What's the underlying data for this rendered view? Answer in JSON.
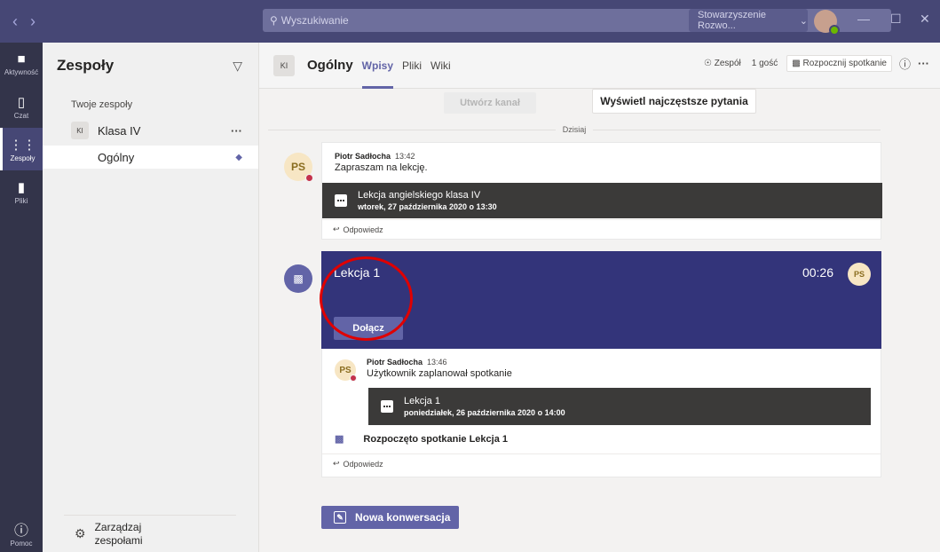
{
  "titlebar": {
    "search_placeholder": "Wyszukiwanie",
    "org_name": "Stowarzyszenie Rozwo...",
    "nav_back": "‹",
    "nav_forward": "›",
    "minimize": "—",
    "maximize": "☐",
    "close": "✕"
  },
  "rail": {
    "items": [
      {
        "label": "Aktywność",
        "icon": "bell-icon"
      },
      {
        "label": "Czat",
        "icon": "chat-icon"
      },
      {
        "label": "Zespoły",
        "icon": "teams-icon"
      },
      {
        "label": "Pliki",
        "icon": "file-icon"
      }
    ],
    "help_label": "Pomoc"
  },
  "panel": {
    "title": "Zespoły",
    "section_label": "Twoje zespoły",
    "team": {
      "initials": "KI",
      "name": "Klasa IV"
    },
    "channel": {
      "name": "Ogólny"
    },
    "manage_line1": "Zarządzaj",
    "manage_line2": "zespołami"
  },
  "channel_header": {
    "initials": "KI",
    "name": "Ogólny",
    "tabs": [
      "Wpisy",
      "Pliki",
      "Wiki"
    ],
    "active_tab": "Wpisy",
    "team_btn": "Zespół",
    "guest_btn": "1 gość",
    "meet_btn": "Rozpocznij spotkanie"
  },
  "conversation": {
    "create_channel": "Utwórz kanał",
    "faq_button": "Wyświetl najczęstsze pytania",
    "date_divider": "Dzisiaj",
    "post1": {
      "initials": "PS",
      "author": "Piotr Sadłocha",
      "time": "13:42",
      "text": "Zapraszam na lekcję.",
      "event_title": "Lekcja angielskiego klasa IV",
      "event_date": "wtorek, 27 października 2020 o 13:30",
      "reply": "Odpowiedz"
    },
    "meeting": {
      "title": "Lekcja 1",
      "elapsed": "00:26",
      "host_initials": "PS",
      "join_label": "Dołącz",
      "author_initials": "PS",
      "author": "Piotr Sadłocha",
      "time": "13:46",
      "text": "Użytkownik zaplanował spotkanie",
      "event_title": "Lekcja 1",
      "event_date": "poniedziałek, 26 października 2020 o 14:00",
      "started_text": "Rozpoczęto spotkanie Lekcja 1",
      "reply": "Odpowiedz"
    },
    "new_conversation": "Nowa konwersacja"
  }
}
